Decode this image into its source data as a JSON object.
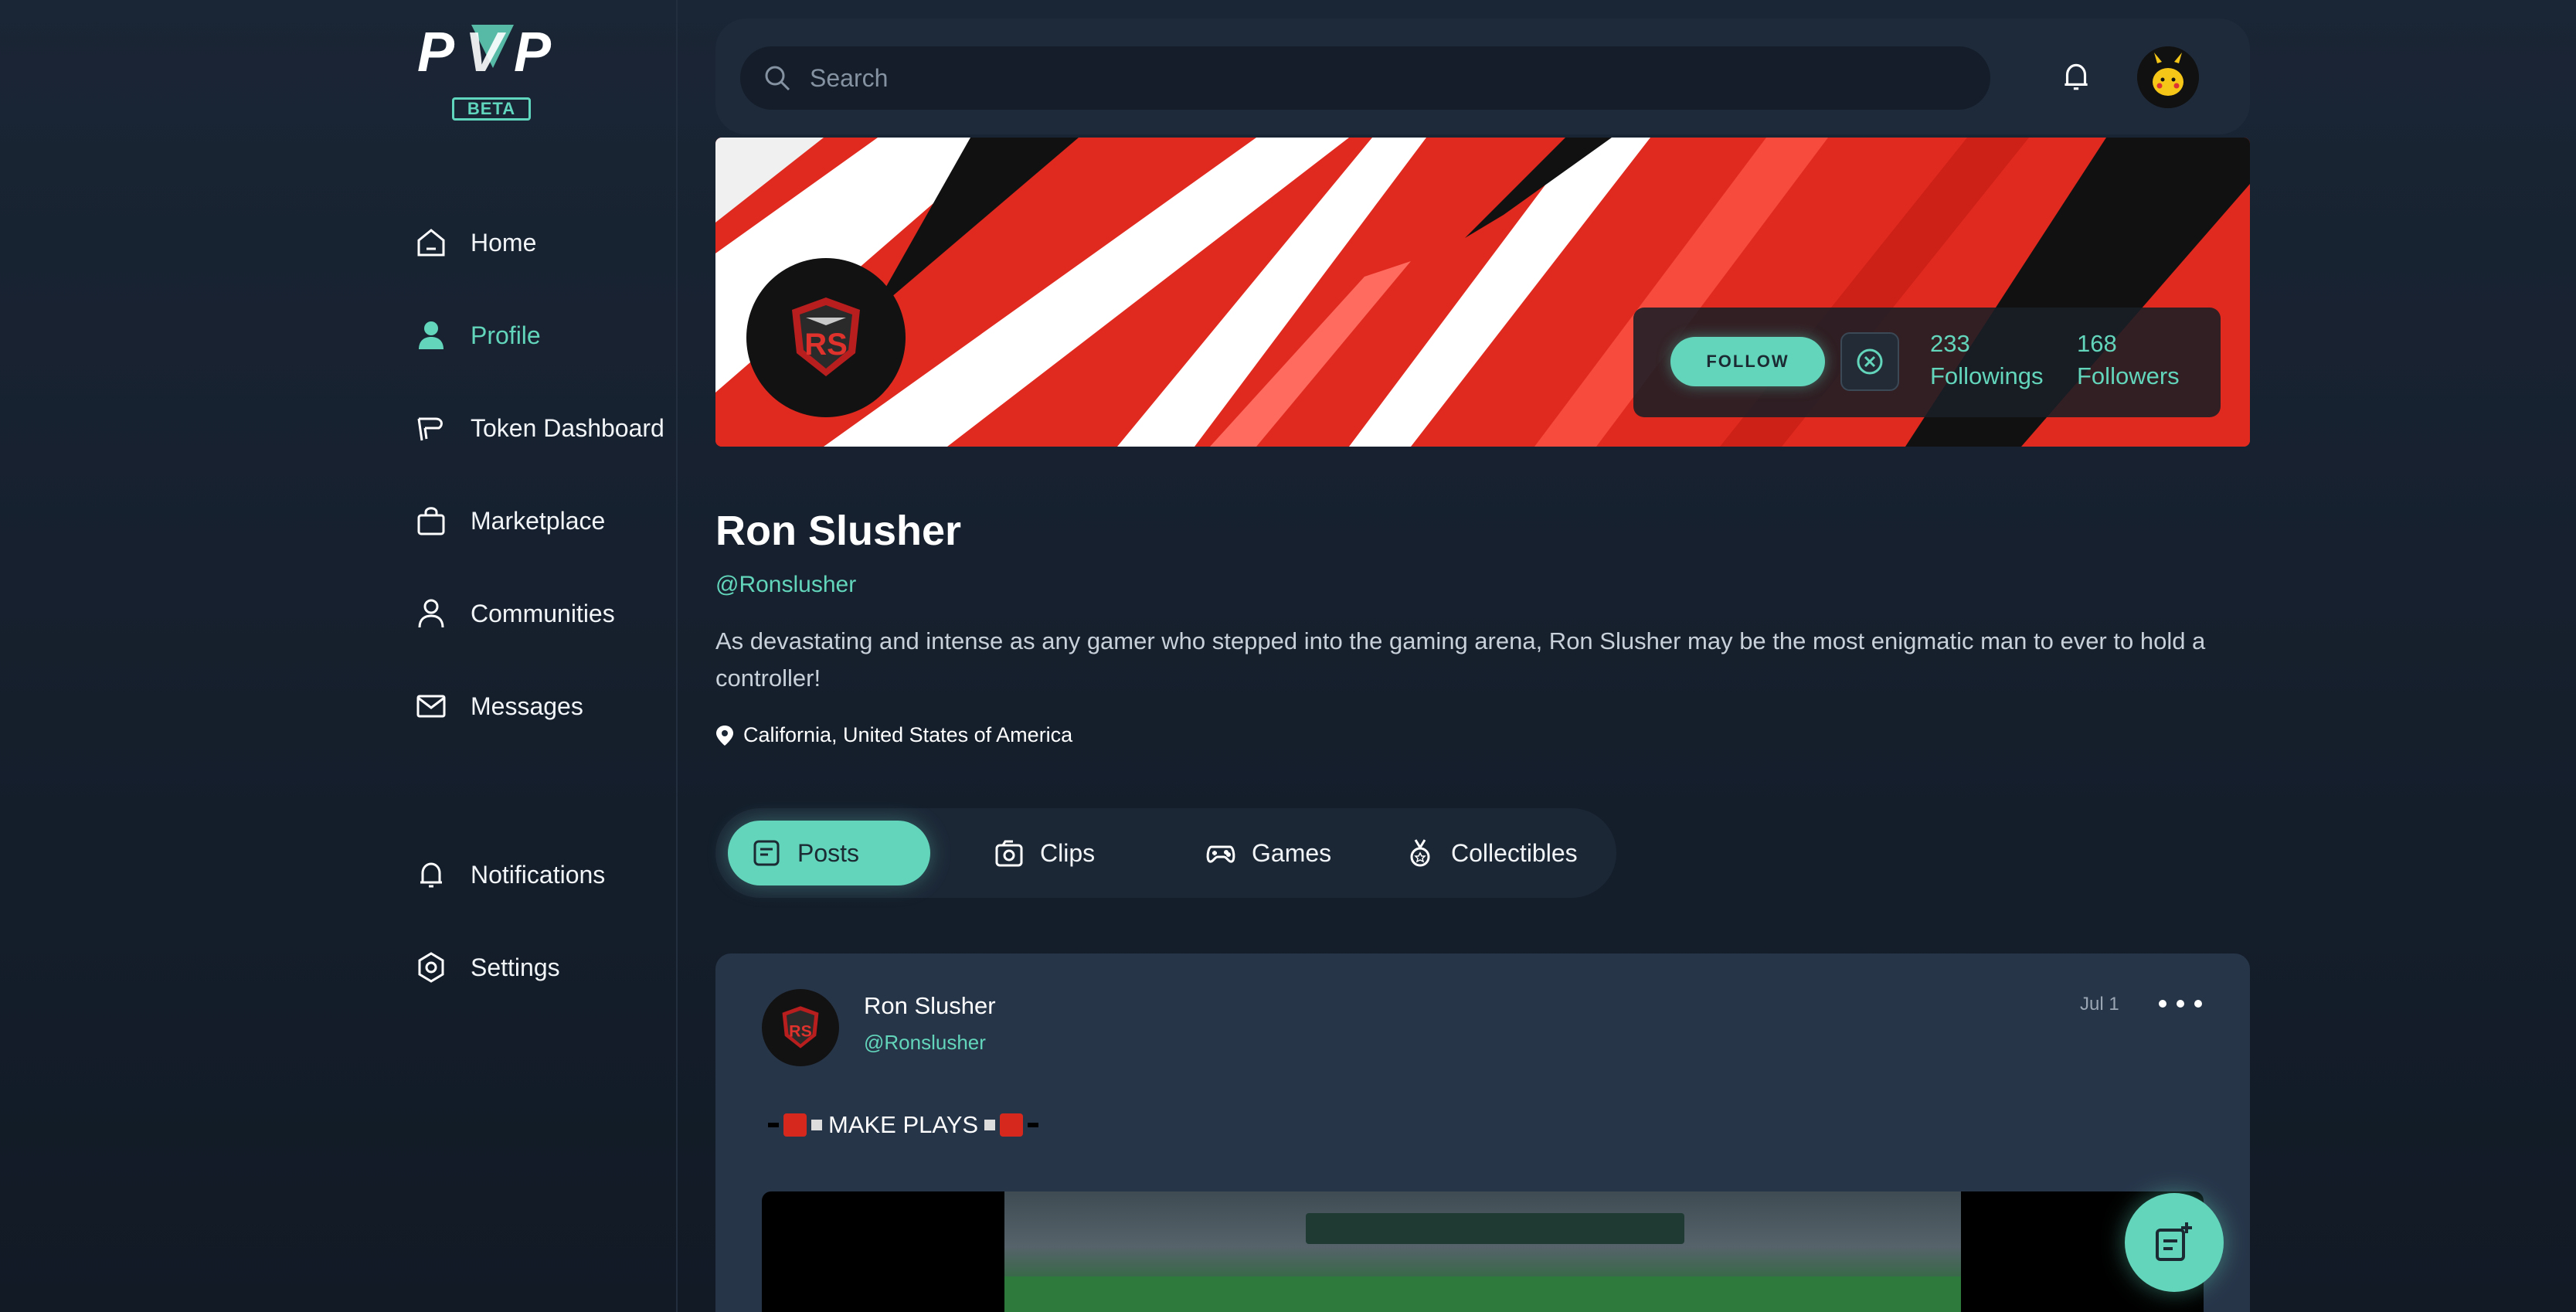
{
  "app": {
    "brand": "PVP",
    "badge": "BETA"
  },
  "sidebar": {
    "items": [
      {
        "label": "Home",
        "icon": "home-icon"
      },
      {
        "label": "Profile",
        "icon": "user-icon",
        "active": true
      },
      {
        "label": "Token Dashboard",
        "icon": "token-icon"
      },
      {
        "label": "Marketplace",
        "icon": "bag-icon"
      },
      {
        "label": "Communities",
        "icon": "person-icon"
      },
      {
        "label": "Messages",
        "icon": "mail-icon"
      },
      {
        "label": "Notifications",
        "icon": "bell-icon"
      },
      {
        "label": "Settings",
        "icon": "gear-icon"
      }
    ]
  },
  "topbar": {
    "search_placeholder": "Search"
  },
  "profile": {
    "follow_label": "FOLLOW",
    "followings_count": "233",
    "followings_label": "Followings",
    "followers_count": "168",
    "followers_label": "Followers",
    "name": "Ron Slusher",
    "handle": "@Ronslusher",
    "bio": "As devastating and intense as any gamer who stepped into the gaming arena, Ron Slusher may be the most enigmatic man to ever to hold a controller!",
    "location": "California, United States of America"
  },
  "tabs": [
    {
      "label": "Posts",
      "icon": "posts-icon",
      "active": true
    },
    {
      "label": "Clips",
      "icon": "camera-icon"
    },
    {
      "label": "Games",
      "icon": "gamepad-icon"
    },
    {
      "label": "Collectibles",
      "icon": "medal-icon"
    }
  ],
  "post": {
    "author": "Ron Slusher",
    "handle": "@Ronslusher",
    "date": "Jul 1",
    "text": "MAKE PLAYS"
  },
  "colors": {
    "accent": "#62d5bb",
    "banner_red": "#e02a1f",
    "background": "#1a2535"
  }
}
